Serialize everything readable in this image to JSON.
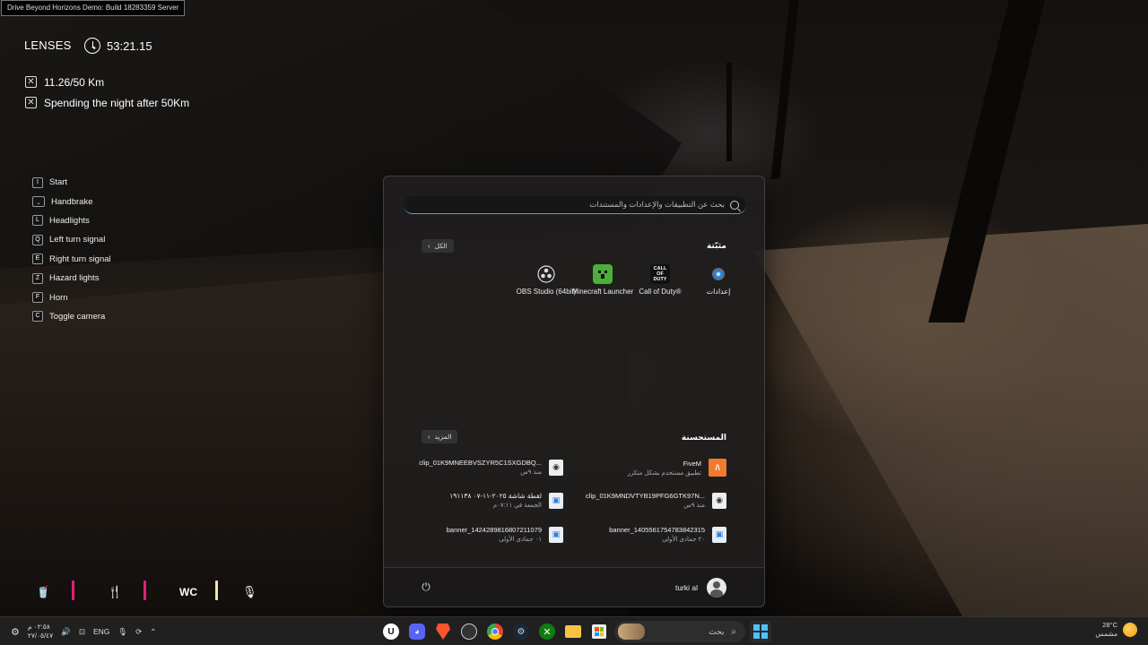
{
  "window_title": "Drive Beyond Horizons Demo: Build 18283359 Server",
  "hud": {
    "lenses": "LENSES",
    "timer": "53:21.15",
    "objectives": [
      {
        "text": "11.26/50 Km"
      },
      {
        "text": "Spending the night after 50Km"
      }
    ],
    "controls": [
      {
        "key": "I",
        "label": "Start"
      },
      {
        "key": "⎵",
        "label": "Handbrake"
      },
      {
        "key": "L",
        "label": "Headlights"
      },
      {
        "key": "Q",
        "label": "Left turn signal"
      },
      {
        "key": "E",
        "label": "Right turn signal"
      },
      {
        "key": "Z",
        "label": "Hazard lights"
      },
      {
        "key": "F",
        "label": "Horn"
      },
      {
        "key": "C",
        "label": "Toggle camera"
      }
    ],
    "status": {
      "wc_label": "WC",
      "colors": {
        "pink": "#e0217a",
        "cream": "#f3e6b0"
      }
    }
  },
  "start_menu": {
    "search_placeholder": "بحث عن التطبيقات والإعدادات والمستندات",
    "pinned_header": "مثبّتة",
    "all_button": "الكل",
    "pinned": [
      {
        "label": "إعدادات",
        "icon": "settings-gear-icon"
      },
      {
        "label": "Call of Duty®",
        "icon": "call-of-duty-icon",
        "icon_text": "CALL OF DUTY"
      },
      {
        "label": "Minecraft Launcher",
        "icon": "minecraft-icon"
      },
      {
        "label": "OBS Studio (64bit)",
        "icon": "obs-icon"
      }
    ],
    "recommended_header": "المستحسنة",
    "more_button": "المزيد",
    "recommended": [
      {
        "name": "FiveM",
        "sub": "تطبيق مستخدم بشكل متكرر",
        "icon": "fivem-icon"
      },
      {
        "name": "clip_01K9MNEEBVSZYR5C1SXGDBQ...",
        "sub": "منذ ٩س",
        "icon": "video-file-icon"
      },
      {
        "name": "clip_01K9MNDVTYB19PFG6GTK97N...",
        "sub": "منذ ٩س",
        "icon": "video-file-icon"
      },
      {
        "name": "لقطة شاشة ٢٠٢٥-١١-٠٧ ١٩١١٣٨",
        "sub": "الجمعة في ٠٧:١١م",
        "icon": "image-file-icon"
      },
      {
        "name": "banner_1405561754783842315",
        "sub": "٢٠ جمادى الأولى",
        "icon": "image-file-icon"
      },
      {
        "name": "banner_1424289816807211079",
        "sub": "٠١ جمادى الأولى",
        "icon": "image-file-icon"
      }
    ],
    "user_name": "turki al"
  },
  "taskbar": {
    "language": "ENG",
    "clock_time": "٠٢:٥٨ م",
    "clock_date": "٢٧/٠٥/٤٧",
    "search_label": "بحث",
    "weather_temp": "28°C",
    "weather_desc": "مشمس"
  }
}
